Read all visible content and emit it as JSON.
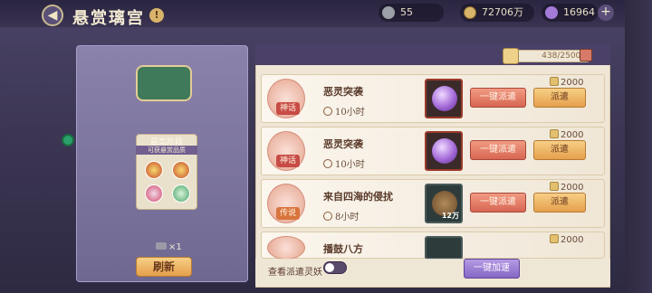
{
  "header": {
    "back_icon": "arrow-left-icon",
    "title": "悬赏璃宫",
    "info_badge": "!",
    "resources": [
      {
        "icon": "speedup-scroll-icon",
        "value": "55"
      },
      {
        "icon": "gold-coin-icon",
        "value": "72706万"
      },
      {
        "icon": "purple-jade-icon",
        "value": "16964"
      }
    ],
    "plus_label": "+"
  },
  "left_panel": {
    "stage_title": "最高阶段",
    "stage_subtitle": "可获悬赏品质",
    "owned_count": "×1",
    "refresh_label": "刷新"
  },
  "scroll": {
    "counter": "438/25000",
    "rows": [
      {
        "rank": "神话",
        "name": "恶灵突袭",
        "time": "10小时",
        "item_qty": "",
        "auto_label": "一键派遣",
        "reward": "2000",
        "send_label": "派遣"
      },
      {
        "rank": "神话",
        "name": "恶灵突袭",
        "time": "10小时",
        "item_qty": "",
        "auto_label": "一键派遣",
        "reward": "2000",
        "send_label": "派遣"
      },
      {
        "rank": "传说",
        "name": "来自四海的侵扰",
        "time": "8小时",
        "item_qty": "12万",
        "auto_label": "一键派遣",
        "reward": "2000",
        "send_label": "派遣"
      },
      {
        "rank": "",
        "name": "播鼓八方",
        "time": "",
        "item_qty": "",
        "auto_label": "",
        "reward": "2000",
        "send_label": ""
      }
    ]
  },
  "bottom": {
    "view_label": "查看派遣灵妖",
    "speedup_label": "一键加速"
  },
  "colors": {
    "accent": "#e5a04c",
    "secondary": "#d76652",
    "purple": "#8467c4"
  }
}
